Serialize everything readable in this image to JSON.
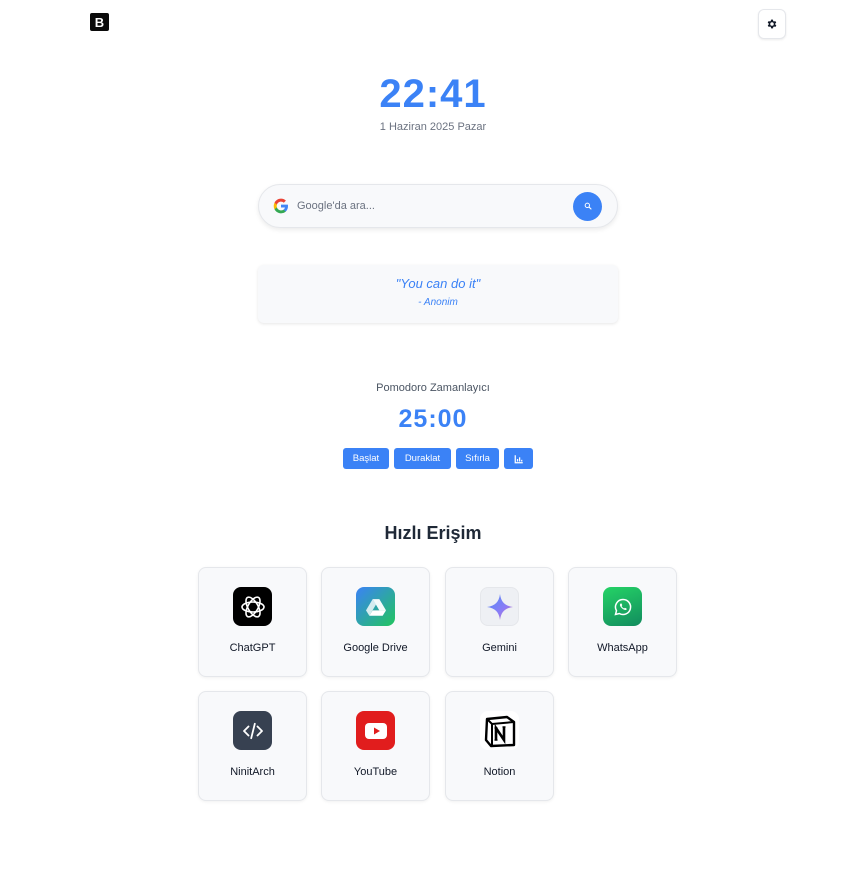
{
  "header": {
    "logo_text": "B",
    "settings_icon": "gear-icon"
  },
  "clock": {
    "time": "22:41",
    "date": "1 Haziran 2025 Pazar"
  },
  "search": {
    "placeholder": "Google'da ara...",
    "value": "",
    "engine_icon": "google-icon",
    "button_icon": "search-icon"
  },
  "quote": {
    "text": "\"You can do it\"",
    "author": "- Anonim"
  },
  "pomodoro": {
    "title": "Pomodoro Zamanlayıcı",
    "time": "25:00",
    "start_label": "Başlat",
    "pause_label": "Duraklat",
    "reset_label": "Sıfırla",
    "stats_icon": "chart-icon"
  },
  "quick_access": {
    "title": "Hızlı Erişim",
    "items": [
      {
        "label": "ChatGPT",
        "icon": "chatgpt-icon",
        "color": "#000000"
      },
      {
        "label": "Google Drive",
        "icon": "google-drive-icon",
        "color": "#34a853"
      },
      {
        "label": "Gemini",
        "icon": "gemini-icon",
        "color": "#4285f4"
      },
      {
        "label": "WhatsApp",
        "icon": "whatsapp-icon",
        "color": "#25d366"
      },
      {
        "label": "NinitArch",
        "icon": "code-icon",
        "color": "#374151"
      },
      {
        "label": "YouTube",
        "icon": "youtube-icon",
        "color": "#e11d1d"
      },
      {
        "label": "Notion",
        "icon": "notion-icon",
        "color": "#000000"
      }
    ]
  },
  "colors": {
    "accent": "#3b82f6",
    "text": "#1f2937",
    "muted": "#6b7280"
  }
}
